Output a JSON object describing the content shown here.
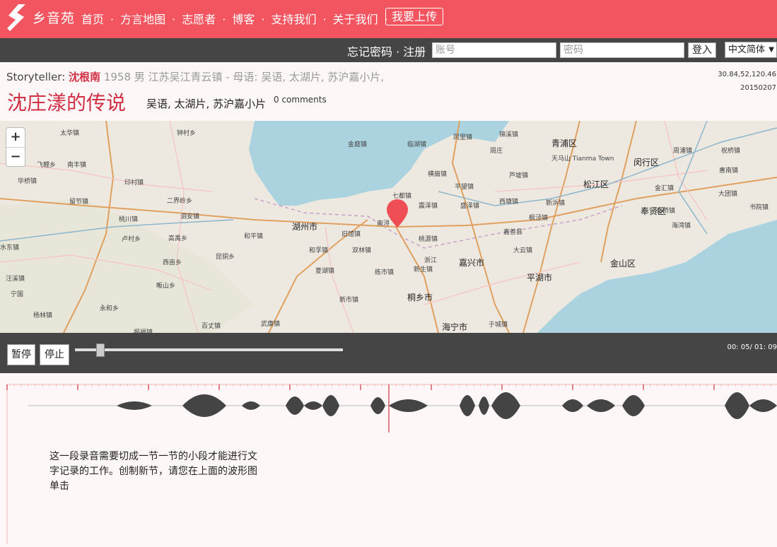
{
  "nav": {
    "brand": "乡音苑",
    "items": [
      "首页",
      "方言地图",
      "志愿者",
      "博客",
      "支持我们",
      "关于我们"
    ],
    "upload": "我要上传"
  },
  "login": {
    "forgot": "忘记密码 · 注册",
    "account_placeholder": "账号",
    "password_placeholder": "密码",
    "login_btn": "登入",
    "language": "中文简体"
  },
  "story": {
    "storyteller_label": "Storyteller:",
    "name": "沈根南",
    "details": "1958 男 江苏吴江青云镇 - 母语: 吴语, 太湖片, 苏沪嘉小片,",
    "coords": "30.84,52,120.46",
    "date": "20150207",
    "title": "沈庄漾的传说",
    "tags": "吴语, 太湖片, 苏沪嘉小片",
    "comments": "0 comments"
  },
  "map": {
    "zoom_in": "+",
    "zoom_out": "−",
    "labels": [
      "太华镇",
      "钟村乡",
      "金庭镇",
      "临湖镇",
      "同里镇",
      "锦溪镇",
      "青浦区",
      "周庄",
      "飞鲤乡",
      "南丰镇",
      "横扇镇",
      "芦墟镇",
      "天马山 Tianma Town",
      "松江区",
      "闵行区",
      "周浦镇",
      "祝桥镇",
      "毕桥镇",
      "印村镇",
      "平望镇",
      "金汇镇",
      "惠南镇",
      "七都镇",
      "震泽镇",
      "盛泽镇",
      "西塘镇",
      "新浜镇",
      "奉贤区",
      "大团镇",
      "留节镇",
      "二界岭乡",
      "湖州市",
      "桃源镇",
      "嘉善县",
      "枫泾镇",
      "南桥镇",
      "书院镇",
      "桃川镇",
      "泗安镇",
      "卢村乡",
      "高禹乡",
      "和平镇",
      "旧馆镇",
      "海湾镇",
      "大云镇",
      "水东镇",
      "西亩乡",
      "和孚镇",
      "双林镇",
      "嘉兴市",
      "金山区",
      "昆铜乡",
      "菱湖镇",
      "练市镇",
      "新生镇",
      "平湖市",
      "汪溪镇",
      "畈山乡",
      "宁国",
      "新市镇",
      "桐乡市",
      "永和乡",
      "杨林镇",
      "武康镇",
      "海宁市",
      "于城镇",
      "浙江",
      "南浔",
      "百丈镇",
      "报福镇",
      "乍浦镇"
    ]
  },
  "player": {
    "pause": "暂停",
    "stop": "停止",
    "progress": 0.095,
    "time": "00: 05/ 01: 09"
  },
  "hint": "这一段录音需要切成一节一节的小段才能进行文字记录的工作。创制新节，请您在上面的波形图单击",
  "colors": {
    "brand": "#f25560",
    "accent_red": "#d12f45",
    "dark_bar": "#454545"
  }
}
